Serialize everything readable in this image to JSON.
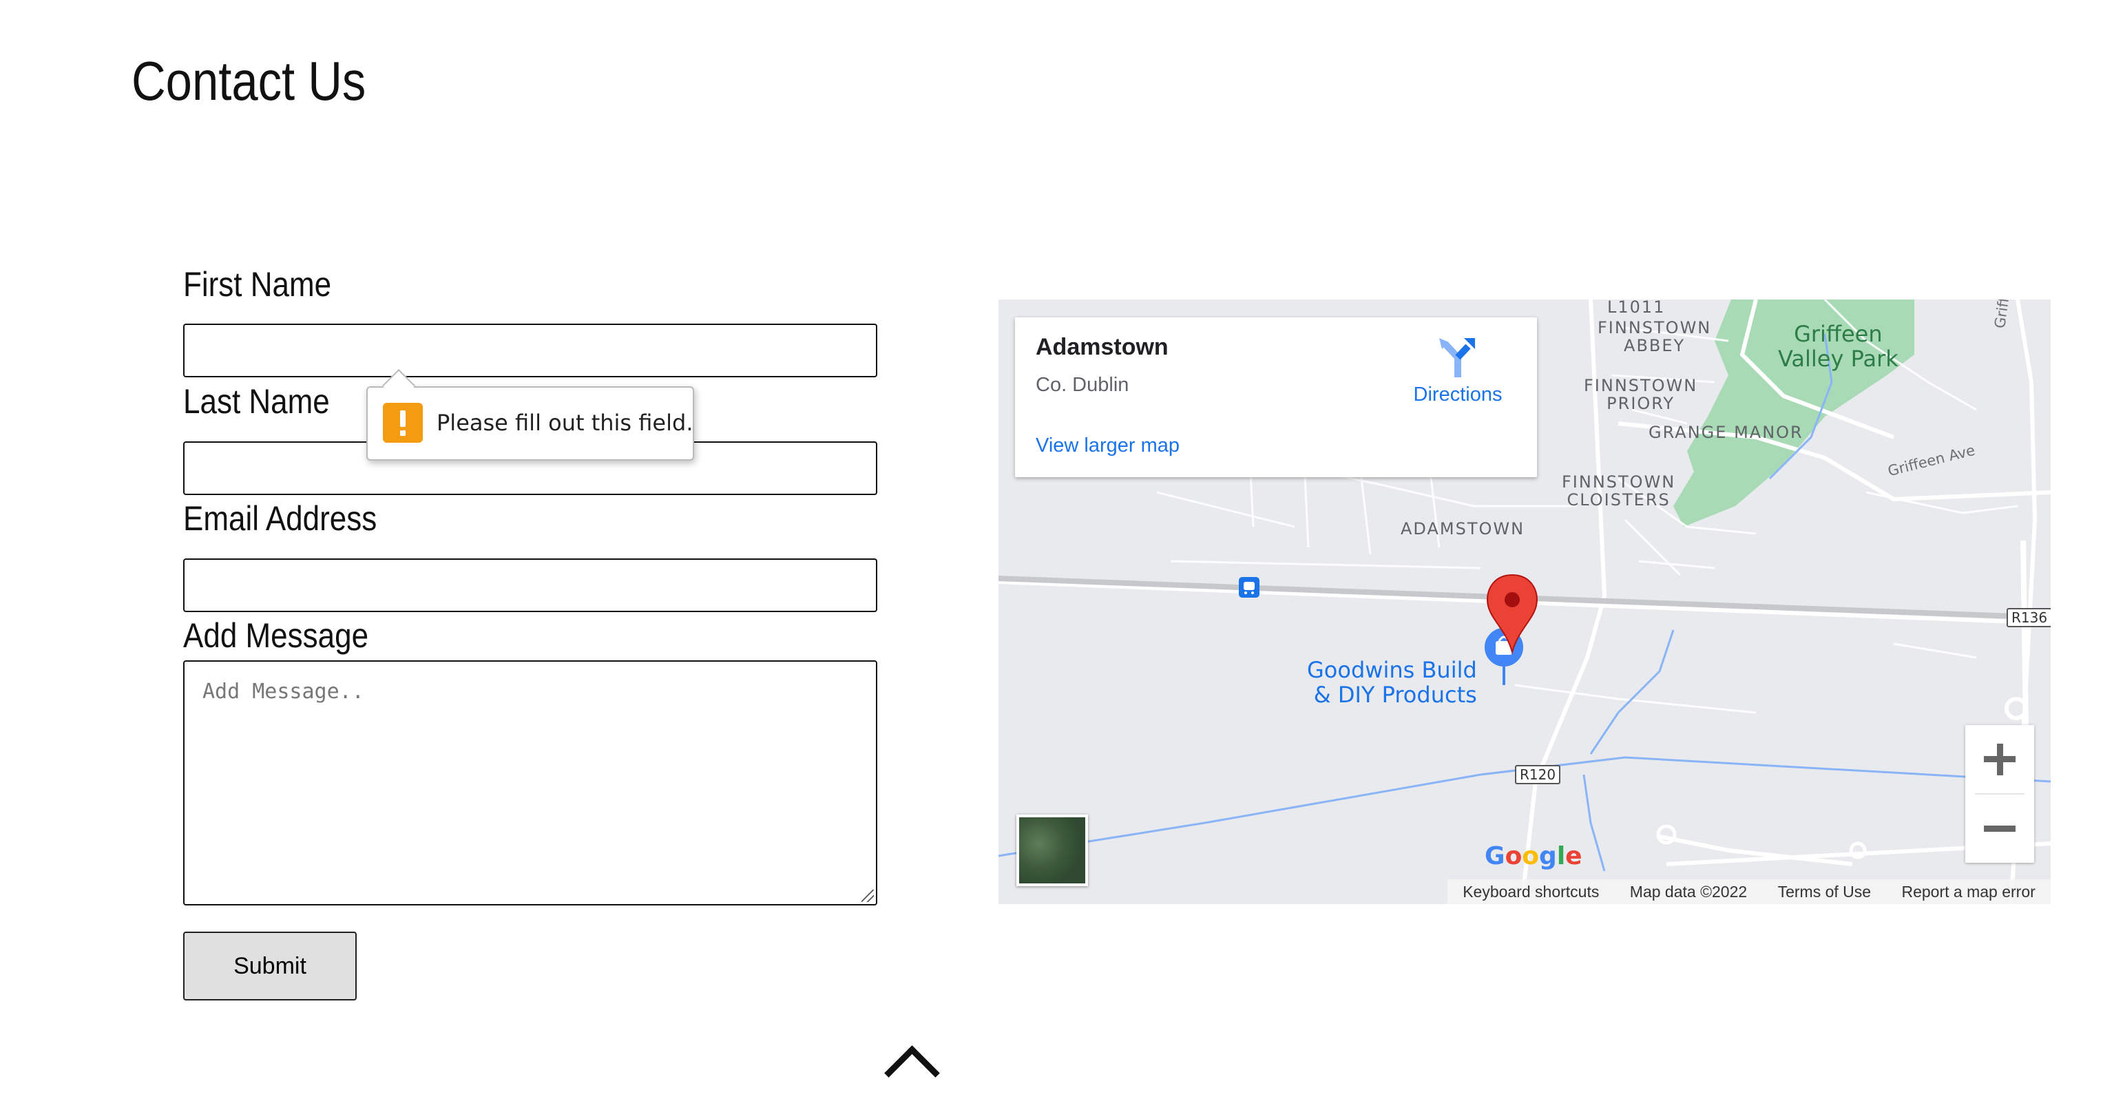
{
  "page": {
    "title": "Contact Us"
  },
  "form": {
    "first_name_label": "First Name",
    "last_name_label": "Last Name",
    "email_label": "Email Address",
    "message_label": "Add Message",
    "message_placeholder": "Add Message..",
    "submit_label": "Submit",
    "validation_tooltip": "Please fill out this field."
  },
  "map": {
    "card": {
      "title": "Adamstown",
      "subtitle": "Co. Dublin",
      "directions_label": "Directions",
      "larger_map_link": "View larger map"
    },
    "area_labels": {
      "finnstown_abbey_1": "FINNSTOWN",
      "finnstown_abbey_2": "ABBEY",
      "finnstown_priory_1": "FINNSTOWN",
      "finnstown_priory_2": "PRIORY",
      "grange_manor": "GRANGE MANOR",
      "finnstown_cloisters_1": "FINNSTOWN",
      "finnstown_cloisters_2": "CLOISTERS",
      "adamstown": "ADAMSTOWN",
      "top_partial": "L1011"
    },
    "park_label_1": "Griffeen",
    "park_label_2": "Valley Park",
    "road_labels": {
      "griffeen_ave": "Griffeen Ave",
      "griffeen_rd": "Griffeen R"
    },
    "shields": {
      "r136": "R136",
      "r120": "R120"
    },
    "poi_line_1": "Goodwins Build",
    "poi_line_2": "& DIY Products",
    "google_logo": {
      "G": "G",
      "o1": "o",
      "o2": "o",
      "g": "g",
      "l": "l",
      "e": "e"
    },
    "attribution": {
      "keyboard": "Keyboard shortcuts",
      "map_data": "Map data ©2022",
      "terms": "Terms of Use",
      "report": "Report a map error"
    },
    "colors": {
      "background": "#e8eaed",
      "park": "#a8dab5",
      "water": "#8ab4f8",
      "marker": "#ea4335",
      "link": "#1a73e8"
    }
  },
  "icons": {
    "warning": "warning-icon",
    "directions": "directions-icon",
    "marker": "map-pin-icon",
    "train": "train-station-icon",
    "shop": "shopping-bag-icon",
    "scroll_top": "chevron-up-icon"
  }
}
